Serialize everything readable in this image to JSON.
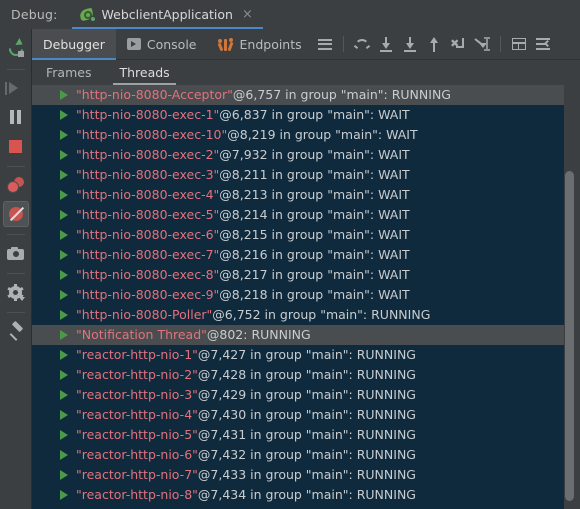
{
  "titlebar": {
    "debug_label": "Debug:",
    "run_config_name": "WebclientApplication",
    "close_label": "×",
    "app_icon": "spring-boot-icon"
  },
  "left_toolbar": {
    "items": [
      {
        "name": "rerun-button",
        "icon": "rerun-icon",
        "enabled": true
      },
      {
        "name": "resume-program-button",
        "icon": "resume-icon",
        "enabled": false
      },
      {
        "name": "pause-program-button",
        "icon": "pause-icon",
        "enabled": true
      },
      {
        "name": "stop-button",
        "icon": "stop-icon",
        "enabled": true
      },
      {
        "name": "view-breakpoints-button",
        "icon": "breakpoints-icon",
        "enabled": true
      },
      {
        "name": "mute-breakpoints-toggle",
        "icon": "mute-breakpoints-icon",
        "enabled": true,
        "active": true
      },
      {
        "name": "screenshot-button",
        "icon": "camera-icon",
        "enabled": true
      },
      {
        "name": "settings-button",
        "icon": "gear-icon",
        "enabled": true
      },
      {
        "name": "pin-tab-button",
        "icon": "pin-icon",
        "enabled": true
      }
    ]
  },
  "tabs": [
    {
      "label": "Debugger",
      "icon": "",
      "selected": true
    },
    {
      "label": "Console",
      "icon": "console-icon",
      "selected": false
    },
    {
      "label": "Endpoints",
      "icon": "endpoints-icon",
      "selected": false
    }
  ],
  "toolbar": {
    "items": [
      {
        "name": "layout-menu-button",
        "icon": "hamburger-icon"
      },
      {
        "name": "step-over-button",
        "icon": "step-over-icon"
      },
      {
        "name": "step-into-button",
        "icon": "step-into-icon"
      },
      {
        "name": "force-step-into-button",
        "icon": "force-step-into-icon"
      },
      {
        "name": "step-out-button",
        "icon": "step-out-icon"
      },
      {
        "name": "drop-frame-button",
        "icon": "drop-frame-icon"
      },
      {
        "name": "run-to-cursor-button",
        "icon": "run-to-cursor-icon"
      },
      {
        "name": "evaluate-expression-button",
        "icon": "evaluate-icon"
      },
      {
        "name": "debugger-settings-button",
        "icon": "settings-lines-icon"
      }
    ]
  },
  "subtabs": [
    {
      "label": "Frames",
      "selected": false
    },
    {
      "label": "Threads",
      "selected": true
    }
  ],
  "threads": [
    {
      "name": "\"http-nio-8080-Acceptor\"",
      "meta": "@6,757 in group \"main\": RUNNING",
      "highlighted": true
    },
    {
      "name": "\"http-nio-8080-exec-1\"",
      "meta": "@6,837 in group \"main\": WAIT",
      "highlighted": false
    },
    {
      "name": "\"http-nio-8080-exec-10\"",
      "meta": "@8,219 in group \"main\": WAIT",
      "highlighted": false
    },
    {
      "name": "\"http-nio-8080-exec-2\"",
      "meta": "@7,932 in group \"main\": WAIT",
      "highlighted": false
    },
    {
      "name": "\"http-nio-8080-exec-3\"",
      "meta": "@8,211 in group \"main\": WAIT",
      "highlighted": false
    },
    {
      "name": "\"http-nio-8080-exec-4\"",
      "meta": "@8,213 in group \"main\": WAIT",
      "highlighted": false
    },
    {
      "name": "\"http-nio-8080-exec-5\"",
      "meta": "@8,214 in group \"main\": WAIT",
      "highlighted": false
    },
    {
      "name": "\"http-nio-8080-exec-6\"",
      "meta": "@8,215 in group \"main\": WAIT",
      "highlighted": false
    },
    {
      "name": "\"http-nio-8080-exec-7\"",
      "meta": "@8,216 in group \"main\": WAIT",
      "highlighted": false
    },
    {
      "name": "\"http-nio-8080-exec-8\"",
      "meta": "@8,217 in group \"main\": WAIT",
      "highlighted": false
    },
    {
      "name": "\"http-nio-8080-exec-9\"",
      "meta": "@8,218 in group \"main\": WAIT",
      "highlighted": false
    },
    {
      "name": "\"http-nio-8080-Poller\"",
      "meta": "@6,752 in group \"main\": RUNNING",
      "highlighted": false
    },
    {
      "name": "\"Notification Thread\"",
      "meta": "@802: RUNNING",
      "highlighted": true
    },
    {
      "name": "\"reactor-http-nio-1\"",
      "meta": "@7,427 in group \"main\": RUNNING",
      "highlighted": false
    },
    {
      "name": "\"reactor-http-nio-2\"",
      "meta": "@7,428 in group \"main\": RUNNING",
      "highlighted": false
    },
    {
      "name": "\"reactor-http-nio-3\"",
      "meta": "@7,429 in group \"main\": RUNNING",
      "highlighted": false
    },
    {
      "name": "\"reactor-http-nio-4\"",
      "meta": "@7,430 in group \"main\": RUNNING",
      "highlighted": false
    },
    {
      "name": "\"reactor-http-nio-5\"",
      "meta": "@7,431 in group \"main\": RUNNING",
      "highlighted": false
    },
    {
      "name": "\"reactor-http-nio-6\"",
      "meta": "@7,432 in group \"main\": RUNNING",
      "highlighted": false
    },
    {
      "name": "\"reactor-http-nio-7\"",
      "meta": "@7,433 in group \"main\": RUNNING",
      "highlighted": false
    },
    {
      "name": "\"reactor-http-nio-8\"",
      "meta": "@7,434 in group \"main\": RUNNING",
      "highlighted": false
    }
  ],
  "colors": {
    "panel_bg": "#3c3f41",
    "list_bg": "#102a3d",
    "row_highlight": "#4a4d4f",
    "thread_name": "#e0737d",
    "thread_meta": "#c8cdd0",
    "accent_blue": "#4a88c7",
    "run_green": "#4a9a4a",
    "stop_red": "#d9534f"
  }
}
